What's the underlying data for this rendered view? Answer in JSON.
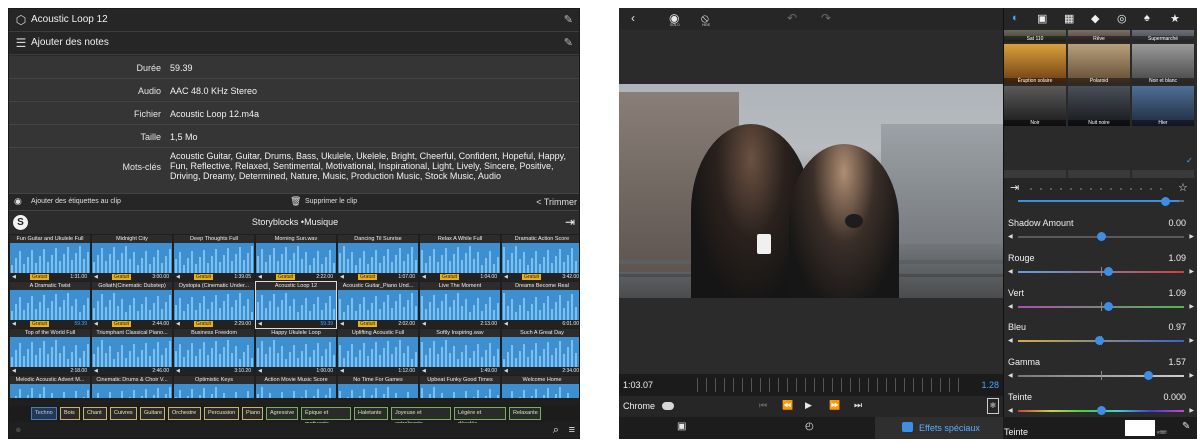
{
  "left": {
    "clip_title": "Acoustic Loop 12",
    "notes_label": "Ajouter des notes",
    "meta": [
      {
        "key": "Durée",
        "value": "59.39"
      },
      {
        "key": "Audio",
        "value": "AAC 48.0 KHz Stereo"
      },
      {
        "key": "Fichier",
        "value": "Acoustic Loop 12.m4a"
      },
      {
        "key": "Taille",
        "value": "1,5 Mo"
      },
      {
        "key": "Mots-clés",
        "value": "Acoustic Guitar, Guitar, Drums, Bass, Ukulele, Ukelele, Bright, Cheerful, Confident, Hopeful, Happy, Fun, Reflective, Relaxed, Sentimental, Motivational, Inspirational, Light, Lively, Sincere, Positive, Driving, Dreamy, Determined, Nature, Music, Production Music, Stock Music, Audio"
      }
    ],
    "clip_actions": {
      "add_tags": "Ajouter des étiquettes au clip",
      "delete": "Supprimer le clip",
      "trim": "< Trimmer"
    },
    "browser_title": "Storyblocks •Musique",
    "tracks": [
      {
        "name": "Fun Guitar and Ukulele Full",
        "tag": "Gratuit",
        "dur": "1:31.00"
      },
      {
        "name": "Midnight City",
        "tag": "Gratuit",
        "dur": "3:00.00"
      },
      {
        "name": "Deep Thoughts Full",
        "tag": "Gratuit",
        "dur": "1:39.05"
      },
      {
        "name": "Morning Sun.wav",
        "tag": "Gratuit",
        "dur": "2:22.00"
      },
      {
        "name": "Dancing Til Sunrise",
        "tag": "Gratuit",
        "dur": "1:07.00"
      },
      {
        "name": "Relax A While Full",
        "tag": "Gratuit",
        "dur": "1:04.00"
      },
      {
        "name": "Dramatic Action Score",
        "tag": "Gratuit",
        "dur": "3:42.00"
      },
      {
        "name": "A Dramatic Twist",
        "tag": "Gratuit",
        "dur": "59.39"
      },
      {
        "name": "Goliath(Cinematic Dubstep)",
        "tag": "Gratuit",
        "dur": "2:44.00"
      },
      {
        "name": "Dystopia (Cinematic Under...",
        "tag": "Gratuit",
        "dur": "2:29.00"
      },
      {
        "name": "Acoustic Loop 12",
        "tag": "",
        "dur": "59.39"
      },
      {
        "name": "Acoustic Guitar_Piano Und...",
        "tag": "Gratuit",
        "dur": "2:02.00"
      },
      {
        "name": "Live The Moment",
        "tag": "",
        "dur": "2:13.00"
      },
      {
        "name": "Dreams Become Real",
        "tag": "",
        "dur": "6:01.00"
      },
      {
        "name": "Top of the World Full",
        "tag": "",
        "dur": "2:18.00"
      },
      {
        "name": "Triumphant Classical Piano...",
        "tag": "",
        "dur": "2:46.00"
      },
      {
        "name": "Business Freedom",
        "tag": "",
        "dur": "3:10.20"
      },
      {
        "name": "Happy Ukulele Loop",
        "tag": "",
        "dur": "1:00.00"
      },
      {
        "name": "Uplifting Acoustic Full",
        "tag": "",
        "dur": "1:12.00"
      },
      {
        "name": "Softly Inspiring.wav",
        "tag": "",
        "dur": "1:49.00"
      },
      {
        "name": "Such A Great Day",
        "tag": "",
        "dur": "2:34.00"
      },
      {
        "name": "Melodic Acoustic Advert M...",
        "tag": "",
        "dur": ""
      },
      {
        "name": "Cinematic Drums & Choir V...",
        "tag": "",
        "dur": ""
      },
      {
        "name": "Optimistic Keys",
        "tag": "",
        "dur": ""
      },
      {
        "name": "Action Movie Music Score",
        "tag": "",
        "dur": ""
      },
      {
        "name": "No Time For Games",
        "tag": "",
        "dur": ""
      },
      {
        "name": "Upbeat Funky Good Times",
        "tag": "",
        "dur": ""
      },
      {
        "name": "Welcome Home",
        "tag": "",
        "dur": ""
      }
    ],
    "chips": [
      "Techno",
      "Bois",
      "Chant",
      "Cuivres",
      "Guitare",
      "Orchestre",
      "Percussion",
      "Piano",
      "Agressive",
      "Épique et motivante",
      "Haletante",
      "Joyeuse et entraînante",
      "Légère et décalée",
      "Relaxante"
    ]
  },
  "right": {
    "eye_labels": [
      "SOLO",
      "HIDE"
    ],
    "time_current": "1:03.07",
    "time_end": "1.28",
    "chrome_label": "Chrome",
    "effects_label": "Effets spéciaux",
    "filters": [
      "Sat 110",
      "Rêve",
      "Supermarché",
      "Éruption solaire",
      "Polaroid",
      "Noir et blanc",
      "Noir",
      "Nuit noire",
      "Hier"
    ],
    "sliders": [
      {
        "name": "Shadow Amount",
        "value": "0.00",
        "pos": 0.5
      },
      {
        "name": "Rouge",
        "value": "1.09",
        "pos": 0.545
      },
      {
        "name": "Vert",
        "value": "1.09",
        "pos": 0.545
      },
      {
        "name": "Bleu",
        "value": "0.97",
        "pos": 0.485
      },
      {
        "name": "Gamma",
        "value": "1.57",
        "pos": 0.785
      },
      {
        "name": "Teinte",
        "value": "0.000",
        "pos": 0.5
      }
    ],
    "last_label": "Teinte",
    "last_value": "#ffffff",
    "accent": "#3d8fe6"
  }
}
